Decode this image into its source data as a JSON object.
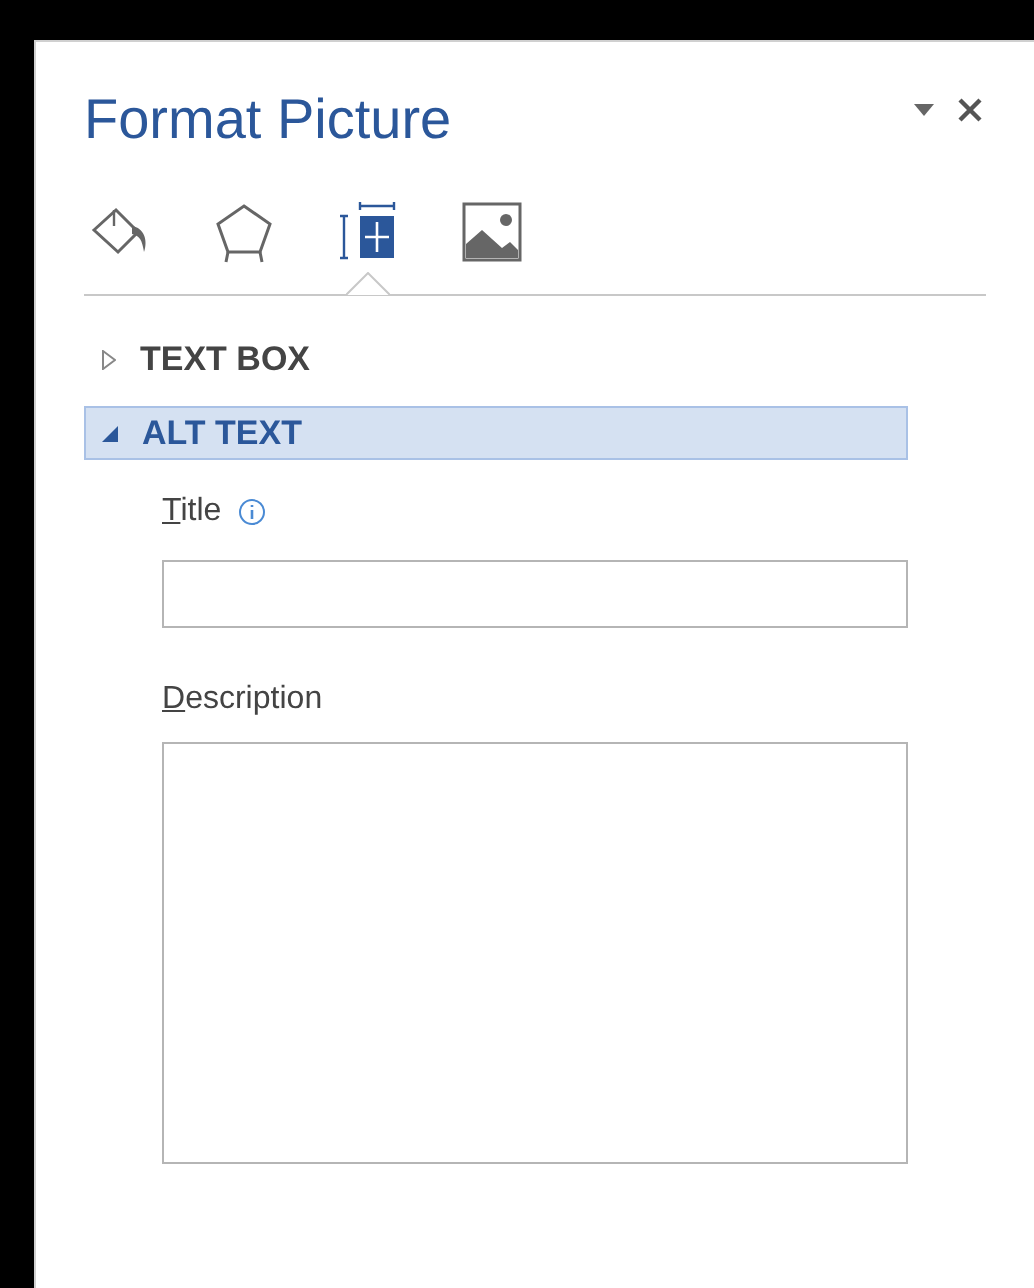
{
  "pane": {
    "title": "Format Picture"
  },
  "tabs": [
    {
      "kind": "fill",
      "selected": false
    },
    {
      "kind": "shape",
      "selected": false
    },
    {
      "kind": "layout",
      "selected": true
    },
    {
      "kind": "picture",
      "selected": false
    }
  ],
  "sections": [
    {
      "label": "TEXT BOX",
      "expanded": false
    },
    {
      "label": "ALT TEXT",
      "expanded": true
    }
  ],
  "fields": [
    {
      "kind": "line",
      "label": "Title",
      "info": true
    },
    {
      "kind": "area",
      "label": "Description",
      "info": false
    }
  ]
}
